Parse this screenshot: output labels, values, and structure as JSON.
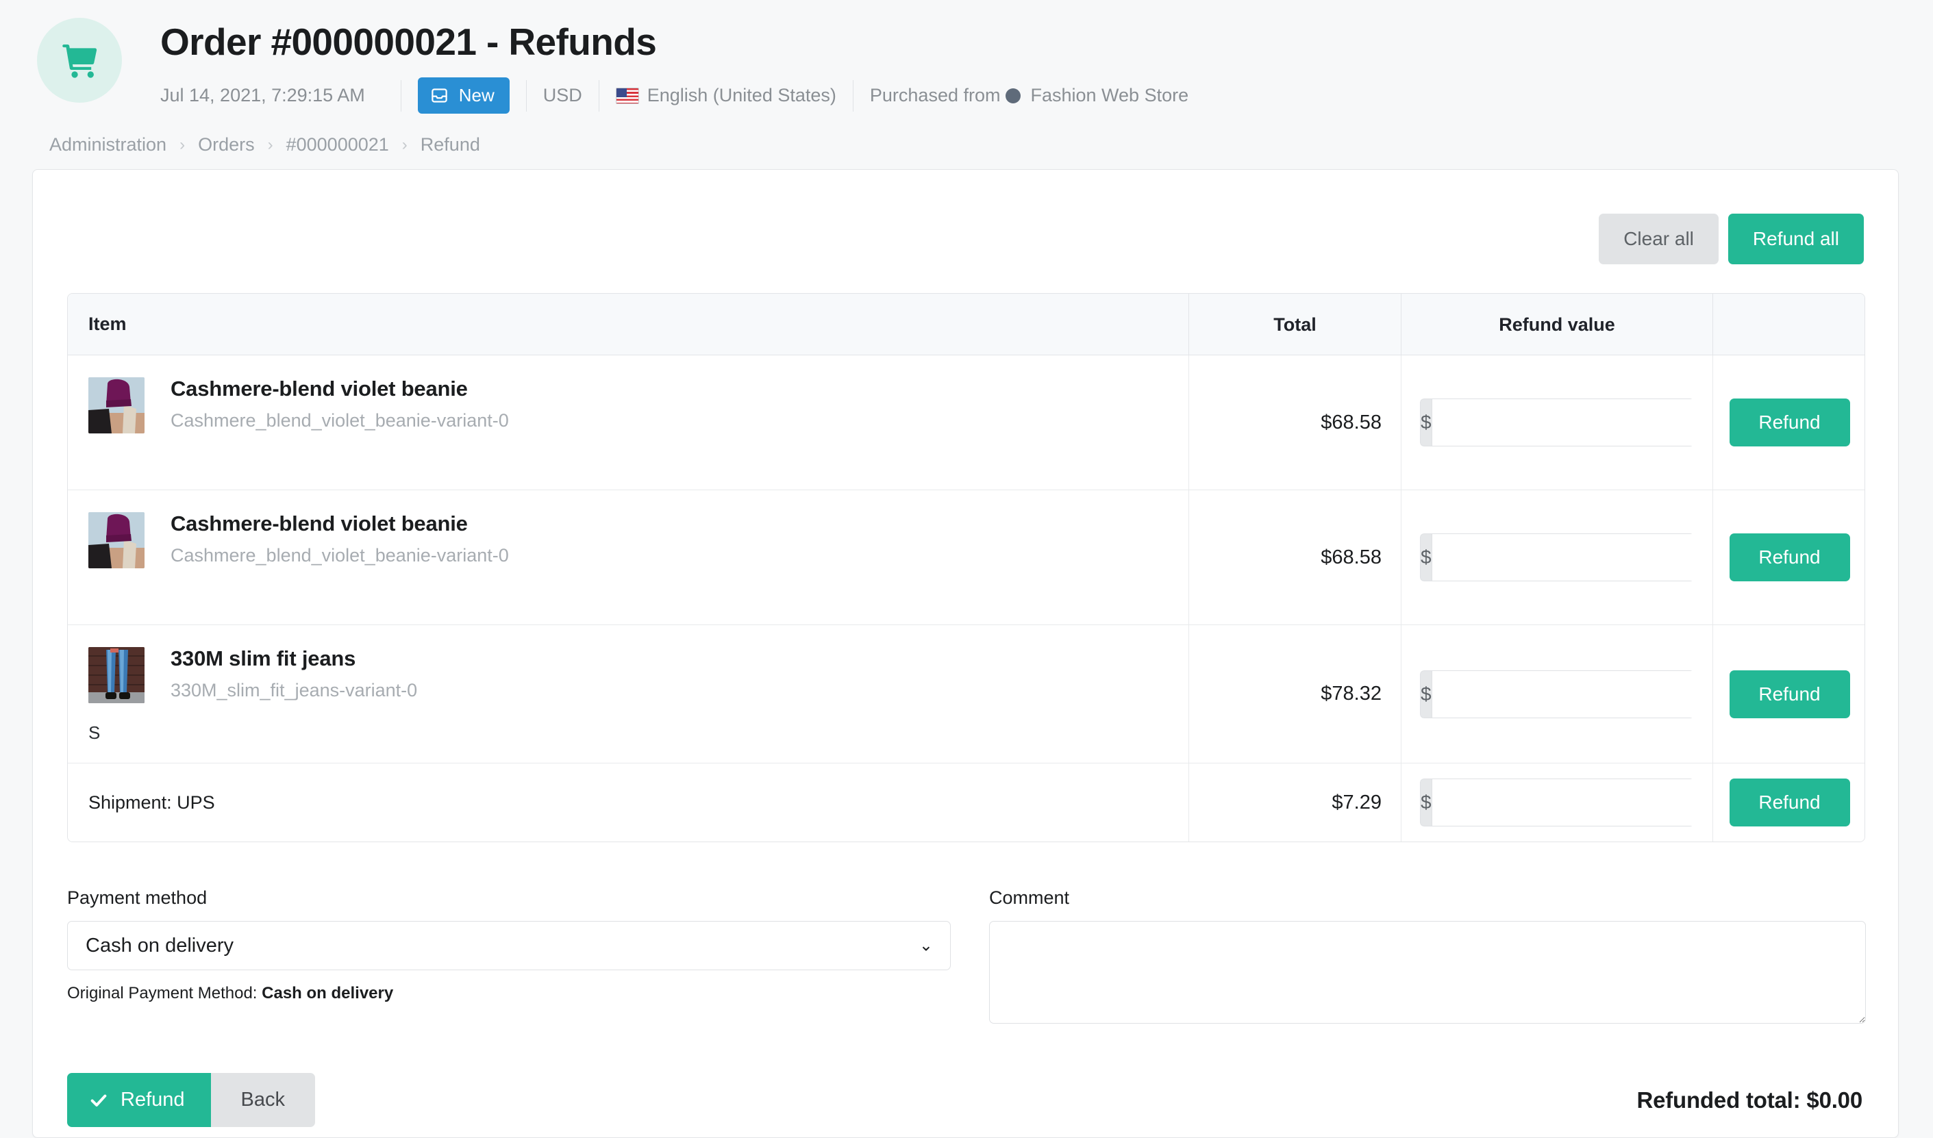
{
  "header": {
    "logo_icon": "shopping-cart-icon",
    "title": "Order #000000021 - Refunds",
    "date": "Jul 14, 2021, 7:29:15 AM",
    "status_badge": "New",
    "status_icon": "inbox-icon",
    "currency": "USD",
    "locale_flag": "us-flag-icon",
    "locale": "English (United States)",
    "purchased_from_label": "Purchased from",
    "store_name": "Fashion Web Store"
  },
  "breadcrumb": {
    "items": [
      "Administration",
      "Orders",
      "#000000021",
      "Refund"
    ],
    "separator": "›"
  },
  "toolbar": {
    "clear_all_label": "Clear all",
    "refund_all_label": "Refund all"
  },
  "table": {
    "columns": [
      "Item",
      "Total",
      "Refund value",
      ""
    ],
    "rows": [
      {
        "name": "Cashmere-blend violet beanie",
        "sku": "Cashmere_blend_violet_beanie-variant-0",
        "option": "",
        "total": "$68.58",
        "currency_prefix": "$",
        "refund_value": "",
        "refund_placeholder": "",
        "action_label": "Refund",
        "thumb": "beanie"
      },
      {
        "name": "Cashmere-blend violet beanie",
        "sku": "Cashmere_blend_violet_beanie-variant-0",
        "option": "",
        "total": "$68.58",
        "currency_prefix": "$",
        "refund_value": "",
        "refund_placeholder": "",
        "action_label": "Refund",
        "thumb": "beanie"
      },
      {
        "name": "330M slim fit jeans",
        "sku": "330M_slim_fit_jeans-variant-0",
        "option": "S",
        "total": "$78.32",
        "currency_prefix": "$",
        "refund_value": "",
        "refund_placeholder": "",
        "action_label": "Refund",
        "thumb": "jeans"
      }
    ],
    "shipment_row": {
      "label": "Shipment: UPS",
      "total": "$7.29",
      "currency_prefix": "$",
      "refund_value": "",
      "refund_placeholder": "",
      "action_label": "Refund"
    }
  },
  "form": {
    "payment_method_label": "Payment method",
    "payment_method_value": "Cash on delivery",
    "payment_method_options": [
      "Cash on delivery"
    ],
    "original_payment_prefix": "Original Payment Method: ",
    "original_payment_value": "Cash on delivery",
    "comment_label": "Comment",
    "comment_value": "",
    "comment_placeholder": ""
  },
  "footer": {
    "refund_label": "Refund",
    "refund_icon": "check-icon",
    "back_label": "Back",
    "refunded_total": "Refunded total: $0.00"
  },
  "colors": {
    "accent_green": "#23b895",
    "badge_blue": "#2a8fd4",
    "page_bg": "#f7f8f9",
    "muted_text": "#9aa0a6"
  }
}
